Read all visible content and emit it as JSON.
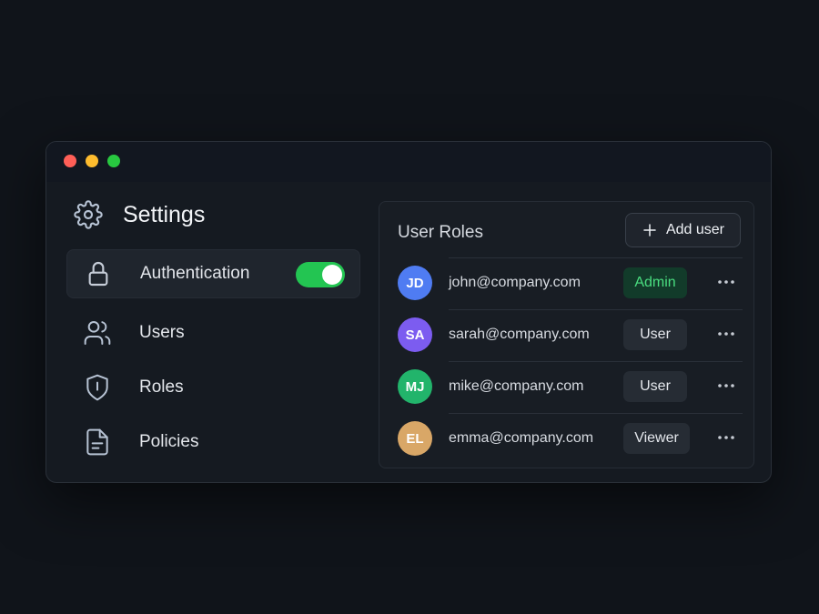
{
  "settings": {
    "title": "Settings"
  },
  "sidebar": {
    "items": [
      {
        "label": "Authentication",
        "icon": "lock-icon",
        "active": true,
        "toggle_on": true
      },
      {
        "label": "Users",
        "icon": "users-icon"
      },
      {
        "label": "Roles",
        "icon": "shield-icon"
      },
      {
        "label": "Policies",
        "icon": "document-icon"
      }
    ]
  },
  "panel": {
    "title": "User Roles",
    "add_user_label": "Add user",
    "users": [
      {
        "initials": "JD",
        "email": "john@company.com",
        "role": "Admin",
        "avatar_color": "#4f7cf2"
      },
      {
        "initials": "SA",
        "email": "sarah@company.com",
        "role": "User",
        "avatar_color": "#7c5cf0"
      },
      {
        "initials": "MJ",
        "email": "mike@company.com",
        "role": "User",
        "avatar_color": "#22b46b"
      },
      {
        "initials": "EL",
        "email": "emma@company.com",
        "role": "Viewer",
        "avatar_color": "#d9a767"
      }
    ]
  },
  "colors": {
    "accent_green": "#23c552",
    "admin_text": "#4ade80",
    "admin_bg": "#123b2a"
  }
}
